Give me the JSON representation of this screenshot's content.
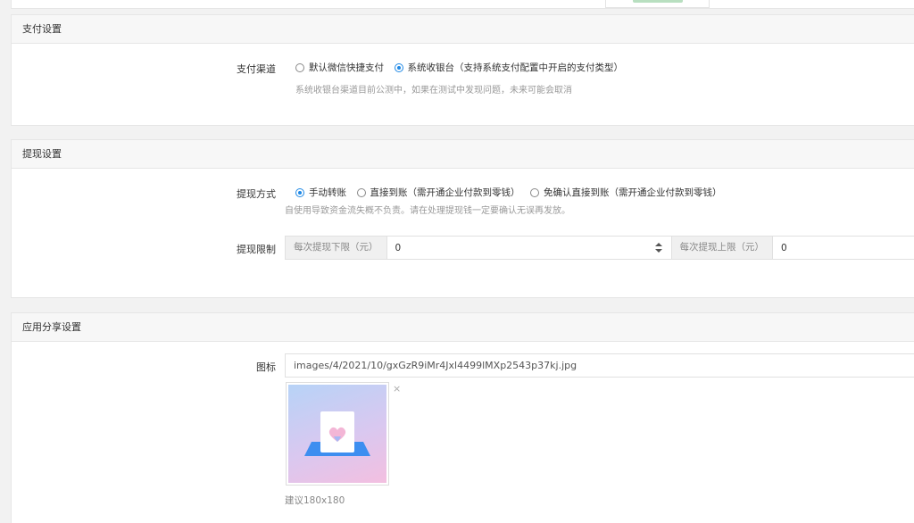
{
  "payment": {
    "title": "支付设置",
    "channel_label": "支付渠道",
    "options": [
      "默认微信快捷支付",
      "系统收银台（支持系统支付配置中开启的支付类型）"
    ],
    "selected_index": 1,
    "help": "系统收银台渠道目前公测中，如果在测试中发现问题，未来可能会取消"
  },
  "withdraw": {
    "title": "提现设置",
    "method_label": "提现方式",
    "options": [
      "手动转账",
      "直接到账（需开通企业付款到零钱）",
      "免确认直接到账（需开通企业付款到零钱）"
    ],
    "selected_index": 0,
    "help": "自使用导致资金流失概不负责。请在处理提现钱一定要确认无误再发放。",
    "limit_label": "提现限制",
    "min_addon": "每次提现下限（元）",
    "min_value": "0",
    "max_addon": "每次提现上限（元）",
    "max_value": "0"
  },
  "share": {
    "title": "应用分享设置",
    "icon_label": "图标",
    "icon_path": "images/4/2021/10/gxGzR9iMr4Jxl4499lMXp2543p37kj.jpg",
    "remove_symbol": "×",
    "hint": "建议180x180"
  },
  "colors": {
    "accent": "#1e88e5",
    "panel_head_bg": "#f7f7f7",
    "page_bg": "#f2f2f2"
  },
  "icons": {
    "spinner": "up-down-arrows-icon",
    "radio": "radio-icon",
    "image": "heart-card-icon",
    "remove": "close-icon"
  }
}
